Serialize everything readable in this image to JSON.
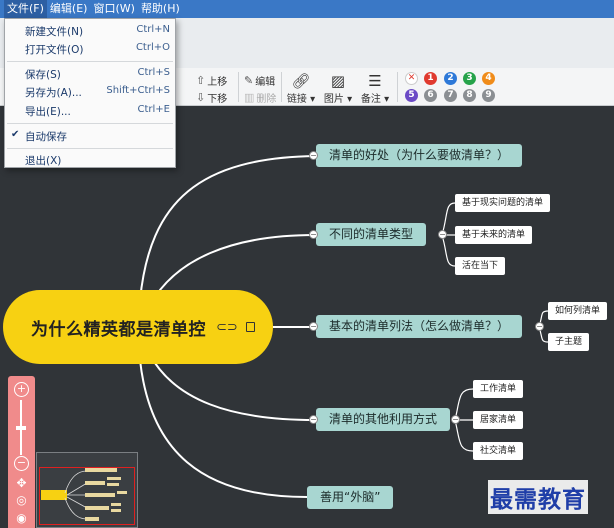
{
  "menubar": {
    "items": [
      {
        "label": "文件(F)",
        "active": true
      },
      {
        "label": "编辑(E)",
        "active": false
      },
      {
        "label": "窗口(W)",
        "active": false
      },
      {
        "label": "帮助(H)",
        "active": false
      }
    ]
  },
  "file_menu": {
    "items": [
      {
        "label": "新建文件(N)",
        "shortcut": "Ctrl+N"
      },
      {
        "label": "打开文件(O)",
        "shortcut": "Ctrl+O"
      },
      {
        "label": "保存(S)",
        "shortcut": "Ctrl+S"
      },
      {
        "label": "另存为(A)...",
        "shortcut": "Shift+Ctrl+S"
      },
      {
        "label": "导出(E)...",
        "shortcut": "Ctrl+E"
      },
      {
        "label": "自动保存",
        "shortcut": "",
        "checked": true
      },
      {
        "label": "退出(X)",
        "shortcut": ""
      }
    ]
  },
  "toolbar": {
    "move_up": "上移",
    "move_down": "下移",
    "edit": "编辑",
    "delete": "删除",
    "link": "链接",
    "image": "图片",
    "note": "备注",
    "priorities_row1": [
      "1",
      "2",
      "3",
      "4"
    ],
    "priorities_row2": [
      "5",
      "6",
      "7",
      "8",
      "9"
    ],
    "priority_colors": {
      "1": "#e03a2f",
      "2": "#2e79d8",
      "3": "#26a34a",
      "4": "#f08c1a",
      "5": "#6b4ac6",
      "6": "#8b8f93",
      "7": "#8b8f93",
      "8": "#8b8f93",
      "9": "#8b8f93",
      "clear": "#e03a2f"
    }
  },
  "mindmap": {
    "root": "为什么精英都是清单控",
    "branches": [
      {
        "label": "清单的好处（为什么要做清单？）",
        "children": []
      },
      {
        "label": "不同的清单类型",
        "children": [
          "基于现实问题的清单",
          "基于未来的清单",
          "活在当下"
        ]
      },
      {
        "label": "基本的清单列法（怎么做清单？）",
        "children": [
          "如何列清单",
          "子主题"
        ]
      },
      {
        "label": "清单的其他利用方式",
        "children": [
          "工作清单",
          "居家清单",
          "社交清单"
        ]
      },
      {
        "label": "善用“外脑”",
        "children": []
      }
    ]
  },
  "watermark": "最需教育"
}
